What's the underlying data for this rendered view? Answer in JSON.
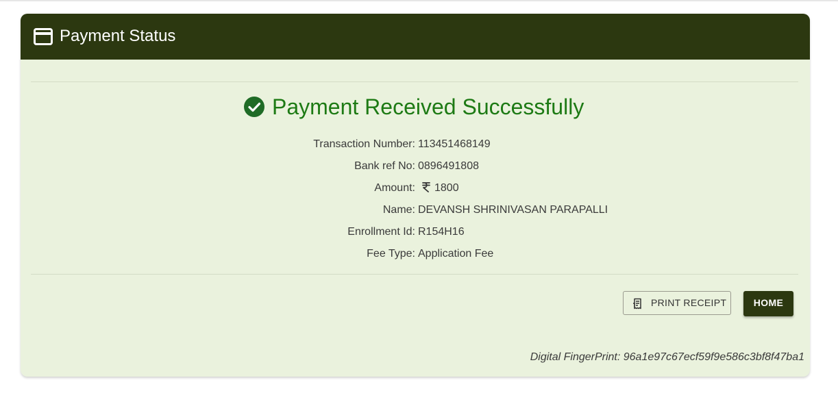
{
  "header": {
    "icon": "credit-card-icon",
    "title": "Payment Status"
  },
  "status": {
    "icon": "check-circle-icon",
    "message": "Payment Received Successfully",
    "color": "#1d7a14"
  },
  "details": [
    {
      "label": "Transaction Number:",
      "value": "113451468149"
    },
    {
      "label": "Bank ref No:",
      "value": "0896491808"
    },
    {
      "label": "Amount:",
      "value": "1800",
      "currency_icon": "rupee-icon"
    },
    {
      "label": "Name:",
      "value": "DEVANSH SHRINIVASAN PARAPALLI"
    },
    {
      "label": "Enrollment Id:",
      "value": "R154H16"
    },
    {
      "label": "Fee Type:",
      "value": "Application Fee"
    }
  ],
  "actions": {
    "print_label": "PRINT RECEIPT",
    "print_icon": "receipt-icon",
    "home_label": "HOME"
  },
  "footer": {
    "fingerprint": "Digital FingerPrint: 96a1e97c67ecf59f9e586c3bf8f47ba1"
  },
  "colors": {
    "header_bg": "#2c3810",
    "card_bg": "#eaf2dd",
    "success": "#1d7a14"
  }
}
